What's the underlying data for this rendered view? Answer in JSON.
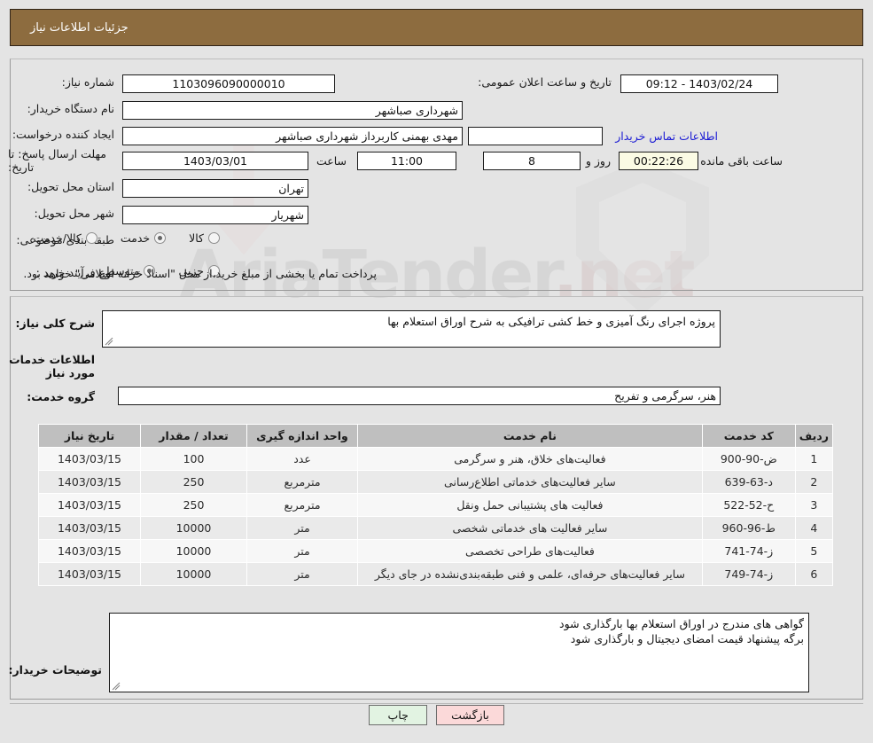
{
  "header": {
    "title": "جزئیات اطلاعات نیاز"
  },
  "watermark": {
    "text": "AriaTender",
    "suffix": ".net"
  },
  "form": {
    "need_number_label": "شماره نیاز:",
    "need_number_value": "1103096090000010",
    "announce_label": "تاریخ و ساعت اعلان عمومی:",
    "announce_value": "1403/02/24 - 09:12",
    "buyer_org_label": "نام دستگاه خریدار:",
    "buyer_org_value": "شهرداری صباشهر",
    "creator_label": "ایجاد کننده درخواست:",
    "creator_value": "مهدی بهمنی کاربرداز شهرداری صباشهر",
    "contact_link": "اطلاعات تماس خریدار",
    "deadline_label": "مهلت ارسال پاسخ: تا تاریخ:",
    "deadline_date": "1403/03/01",
    "hour_label": "ساعت",
    "deadline_time": "11:00",
    "days_value": "8",
    "days_label": "روز و",
    "countdown_value": "00:22:26",
    "remaining_label": "ساعت باقی مانده",
    "province_label": "استان محل تحویل:",
    "province_value": "تهران",
    "city_label": "شهر محل تحویل:",
    "city_value": "شهریار",
    "category_label": "طبقه بندی موضوعی:",
    "category_options": [
      {
        "label": "کالا",
        "selected": false
      },
      {
        "label": "خدمت",
        "selected": true
      },
      {
        "label": "کالا/خدمت",
        "selected": false
      }
    ],
    "process_label": "نوع فرآیند خرید :",
    "process_options": [
      {
        "label": "جزیی",
        "selected": false
      },
      {
        "label": "متوسط",
        "selected": true
      }
    ],
    "process_note": "پرداخت تمام یا بخشی از مبلغ خرید،از محل \"اسناد خزانه اسلامی\" خواهد بود."
  },
  "description": {
    "label": "شرح کلی نیاز:",
    "value": "پروژه اجرای رنگ آمیزی و خط کشی ترافیکی به شرح اوراق استعلام بها"
  },
  "services_section": {
    "heading": "اطلاعات خدمات مورد نیاز",
    "group_label": "گروه خدمت:",
    "group_value": "هنر، سرگرمی و تفریح"
  },
  "table": {
    "columns": [
      "ردیف",
      "کد خدمت",
      "نام خدمت",
      "واحد اندازه گیری",
      "تعداد / مقدار",
      "تاریخ نیاز"
    ],
    "rows": [
      {
        "no": "1",
        "code": "ض-90-900",
        "name": "فعالیت‌های خلاق، هنر و سرگرمی",
        "unit": "عدد",
        "qty": "100",
        "date": "1403/03/15"
      },
      {
        "no": "2",
        "code": "د-63-639",
        "name": "سایر فعالیت‌های خدماتی اطلاع‌رسانی",
        "unit": "مترمربع",
        "qty": "250",
        "date": "1403/03/15"
      },
      {
        "no": "3",
        "code": "ح-52-522",
        "name": "فعالیت های پشتیبانی حمل ونقل",
        "unit": "مترمربع",
        "qty": "250",
        "date": "1403/03/15"
      },
      {
        "no": "4",
        "code": "ط-96-960",
        "name": "سایر فعالیت های خدماتی شخصی",
        "unit": "متر",
        "qty": "10000",
        "date": "1403/03/15"
      },
      {
        "no": "5",
        "code": "ز-74-741",
        "name": "فعالیت‌های طراحی تخصصی",
        "unit": "متر",
        "qty": "10000",
        "date": "1403/03/15"
      },
      {
        "no": "6",
        "code": "ز-74-749",
        "name": "سایر فعالیت‌های حرفه‌ای، علمی و فنی طبقه‌بندی‌نشده در جای دیگر",
        "unit": "متر",
        "qty": "10000",
        "date": "1403/03/15"
      }
    ]
  },
  "buyer_notes": {
    "label": "توضیحات خریدار:",
    "line1": "گواهی های مندرج در اوراق استعلام بها بارگذاری شود",
    "line2": "برگه پیشنهاد قیمت امضای دیجیتال و بارگذاری شود"
  },
  "footer": {
    "print_label": "چاپ",
    "back_label": "بازگشت"
  },
  "colors": {
    "header_bg": "#8d6c3f",
    "link": "#1b1bd4",
    "timer_bg": "#fbfbe4",
    "print_bg": "#e2f3e2",
    "back_bg": "#fbd9d9",
    "table_header_bg": "#bfbfbf",
    "page_bg": "#e4e4e4"
  }
}
